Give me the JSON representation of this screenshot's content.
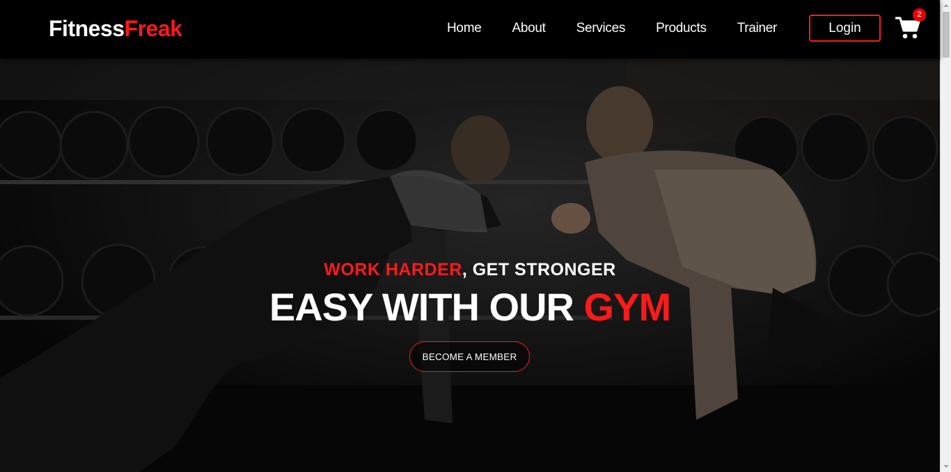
{
  "brand": {
    "part1": "Fitness",
    "part2": "Freak",
    "accent_color": "#ff1a1a"
  },
  "nav": {
    "links": [
      {
        "label": "Home"
      },
      {
        "label": "About"
      },
      {
        "label": "Services"
      },
      {
        "label": "Products"
      },
      {
        "label": "Trainer"
      }
    ],
    "login_label": "Login",
    "cart_icon": "shopping-cart-icon",
    "cart_count": "2"
  },
  "hero": {
    "tagline_red": "WORK HARDER",
    "tagline_white": ", GET STRONGER",
    "headline_white": "EASY WITH OUR ",
    "headline_red": "GYM",
    "cta_label": "BECOME A MEMBER"
  }
}
